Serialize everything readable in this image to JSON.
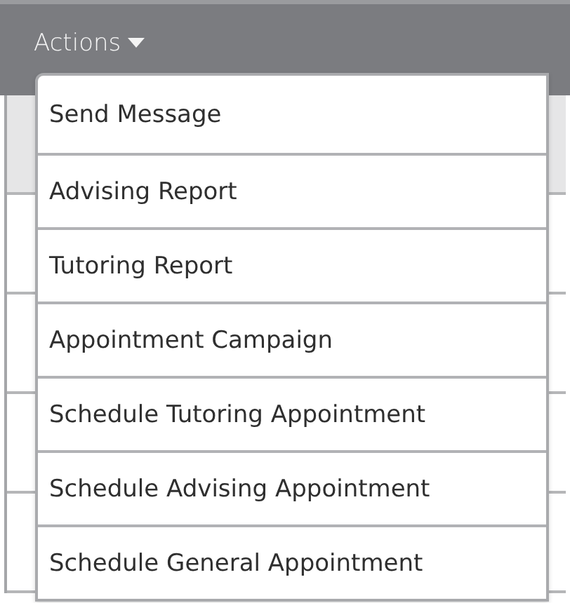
{
  "header": {
    "menu_button": {
      "label": "Actions",
      "expanded": true
    }
  },
  "background_rows": [
    {
      "shaded": true
    },
    {
      "shaded": false
    },
    {
      "shaded": false
    },
    {
      "shaded": false
    },
    {
      "shaded": false
    }
  ],
  "menu": {
    "items": [
      {
        "label": "Send Message"
      },
      {
        "label": "Advising Report"
      },
      {
        "label": "Tutoring Report"
      },
      {
        "label": "Appointment Campaign"
      },
      {
        "label": "Schedule Tutoring Appointment"
      },
      {
        "label": "Schedule Advising Appointment"
      },
      {
        "label": "Schedule General Appointment"
      }
    ]
  }
}
